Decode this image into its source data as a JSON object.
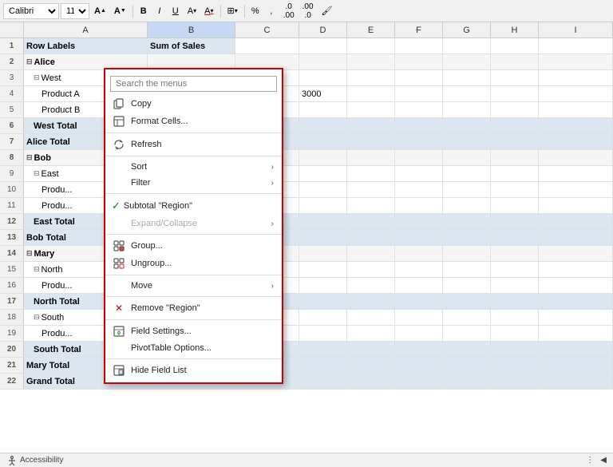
{
  "toolbar": {
    "font_family": "Calibri",
    "font_size": "11",
    "buttons": [
      "B",
      "I",
      "U",
      "A",
      "borders",
      "%",
      "comma",
      "format"
    ],
    "size_increase": "A",
    "size_decrease": "A"
  },
  "columns": {
    "headers": [
      "A",
      "B",
      "C",
      "D",
      "E",
      "F",
      "G",
      "H",
      "I"
    ]
  },
  "rows": [
    {
      "num": "1",
      "a": "Row Labels",
      "b": "Sum of Sales",
      "style": "header"
    },
    {
      "num": "2",
      "a": "⊟ Alice",
      "style": "bold"
    },
    {
      "num": "3",
      "a": "  ⊟ West",
      "style": "indent1"
    },
    {
      "num": "4",
      "a": "    Product A",
      "b": "",
      "d": "3000",
      "style": "indent2"
    },
    {
      "num": "5",
      "a": "    Product B",
      "style": "indent2"
    },
    {
      "num": "6",
      "a": "  West Total",
      "style": "total"
    },
    {
      "num": "7",
      "a": "Alice Total",
      "style": "total"
    },
    {
      "num": "8",
      "a": "⊟ Bob",
      "style": "bold"
    },
    {
      "num": "9",
      "a": "  ⊟ East",
      "style": "indent1"
    },
    {
      "num": "10",
      "a": "    Produ...",
      "style": "indent2"
    },
    {
      "num": "11",
      "a": "    Produ...",
      "style": "indent2"
    },
    {
      "num": "12",
      "a": "  East Total",
      "style": "total"
    },
    {
      "num": "13",
      "a": "Bob Total",
      "style": "total"
    },
    {
      "num": "14",
      "a": "⊟ Mary",
      "style": "bold"
    },
    {
      "num": "15",
      "a": "  ⊟ North",
      "style": "indent1"
    },
    {
      "num": "16",
      "a": "    Produ...",
      "style": "indent2"
    },
    {
      "num": "17",
      "a": "  North Total",
      "style": "total"
    },
    {
      "num": "18",
      "a": "  ⊟ South",
      "style": "indent1"
    },
    {
      "num": "19",
      "a": "    Produ...",
      "style": "indent2"
    },
    {
      "num": "20",
      "a": "  South Total",
      "style": "total"
    },
    {
      "num": "21",
      "a": "Mary Total",
      "style": "total"
    },
    {
      "num": "22",
      "a": "Grand Total",
      "style": "grand"
    }
  ],
  "context_menu": {
    "search_placeholder": "Search the menus",
    "items": [
      {
        "label": "Copy",
        "icon": "copy",
        "has_arrow": false,
        "disabled": false
      },
      {
        "label": "Format Cells...",
        "icon": "format-cells",
        "has_arrow": false,
        "disabled": false
      },
      {
        "divider": true
      },
      {
        "label": "Refresh",
        "icon": "refresh",
        "has_arrow": false,
        "disabled": false
      },
      {
        "divider": true
      },
      {
        "label": "Sort",
        "icon": "",
        "has_arrow": true,
        "disabled": false
      },
      {
        "label": "Filter",
        "icon": "",
        "has_arrow": true,
        "disabled": false
      },
      {
        "divider": true
      },
      {
        "label": "Subtotal \"Region\"",
        "icon": "check",
        "has_arrow": false,
        "disabled": false
      },
      {
        "label": "Expand/Collapse",
        "icon": "",
        "has_arrow": true,
        "disabled": true
      },
      {
        "divider": true
      },
      {
        "label": "Group...",
        "icon": "group",
        "has_arrow": false,
        "disabled": false
      },
      {
        "label": "Ungroup...",
        "icon": "ungroup",
        "has_arrow": false,
        "disabled": false
      },
      {
        "divider": true
      },
      {
        "label": "Move",
        "icon": "",
        "has_arrow": true,
        "disabled": false
      },
      {
        "divider": true
      },
      {
        "label": "Remove \"Region\"",
        "icon": "remove",
        "has_arrow": false,
        "disabled": false
      },
      {
        "divider": true
      },
      {
        "label": "Field Settings...",
        "icon": "field-settings",
        "has_arrow": false,
        "disabled": false
      },
      {
        "label": "PivotTable Options...",
        "icon": "",
        "has_arrow": false,
        "disabled": false
      },
      {
        "divider": true
      },
      {
        "label": "Hide Field List",
        "icon": "hide-list",
        "has_arrow": false,
        "disabled": false
      }
    ]
  },
  "status_bar": {
    "accessibility_label": "Accessibility",
    "dots_icon": "⋮",
    "arrow_icon": "◀"
  }
}
